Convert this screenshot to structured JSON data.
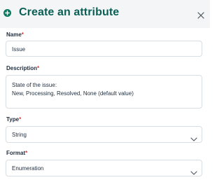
{
  "dialog": {
    "title": "Create an attribute",
    "icons": {
      "header": "plus-circle-icon",
      "close": "close-icon",
      "select": "chevron-down-icon"
    },
    "colors": {
      "accent": "#0b7a63",
      "title": "#0b5f55",
      "required": "#d63a3a",
      "header_bg": "#f3f5f7"
    }
  },
  "form": {
    "name": {
      "label": "Name",
      "required_mark": "*",
      "value": "Issue"
    },
    "description": {
      "label": "Description",
      "required_mark": "*",
      "line1": "State of the issue:",
      "line2": "New, Processing, Resolved, None (default value)"
    },
    "type": {
      "label": "Type",
      "required_mark": "*",
      "value": "String"
    },
    "format": {
      "label": "Format",
      "required_mark": "*",
      "value": "Enumeration"
    }
  }
}
